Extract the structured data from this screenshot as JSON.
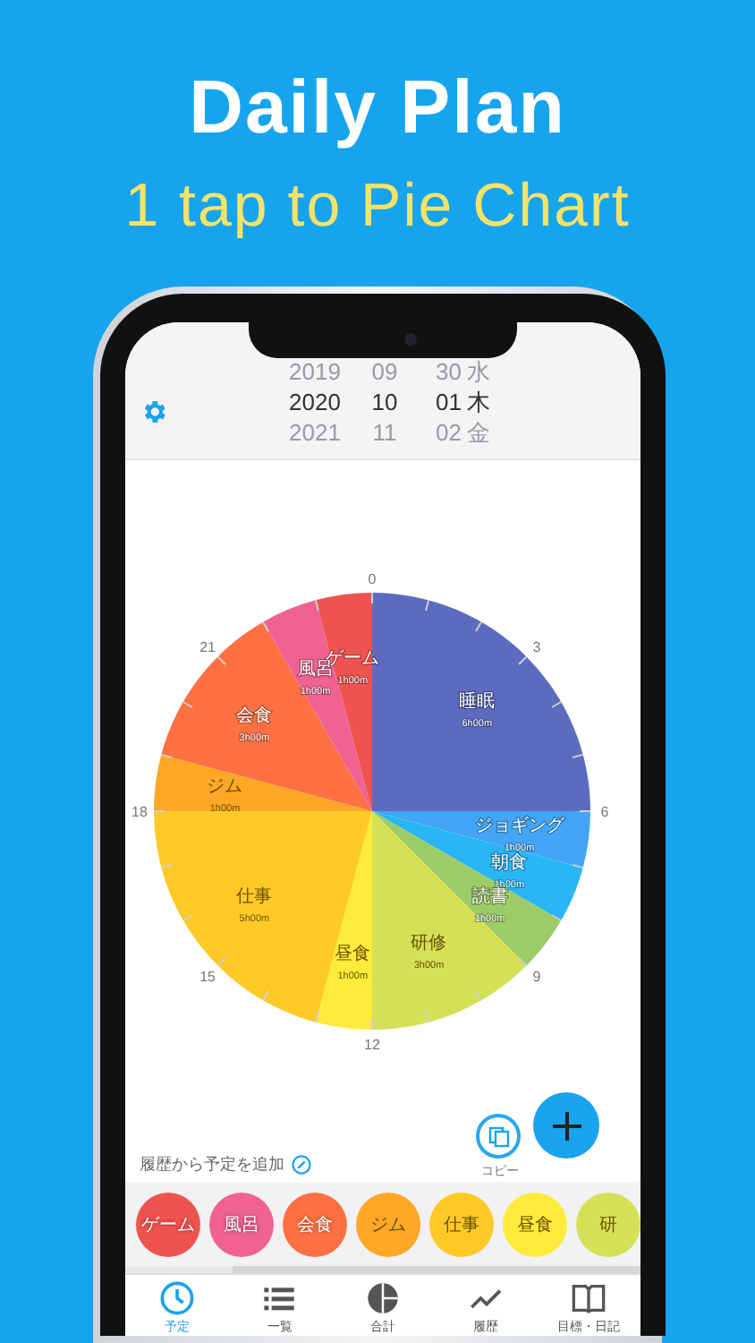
{
  "headline": "Daily Plan",
  "subtitle": "1 tap to Pie Chart",
  "date_picker": {
    "rows": [
      {
        "year": "2019",
        "month": "09",
        "day": "30",
        "weekday": "水",
        "selected": false
      },
      {
        "year": "2020",
        "month": "10",
        "day": "01",
        "weekday": "木",
        "selected": true
      },
      {
        "year": "2021",
        "month": "11",
        "day": "02",
        "weekday": "金",
        "selected": false
      }
    ]
  },
  "chart_data": {
    "type": "pie",
    "categories": [
      "睡眠",
      "ジョギング",
      "朝食",
      "読書",
      "研修",
      "昼食",
      "仕事",
      "ジム",
      "会食",
      "風呂",
      "ゲーム"
    ],
    "values": [
      6,
      1,
      1,
      1,
      3,
      1,
      5,
      1,
      3,
      1,
      1
    ],
    "value_labels": [
      "6h00m",
      "1h00m",
      "1h00m",
      "1h00m",
      "3h00m",
      "1h00m",
      "5h00m",
      "1h00m",
      "3h00m",
      "1h00m",
      "1h00m"
    ],
    "colors": [
      "#5c6bc0",
      "#42a5f5",
      "#29b6f6",
      "#9ccc65",
      "#d4e157",
      "#ffeb3b",
      "#ffca28",
      "#ffa726",
      "#ff7043",
      "#f06292",
      "#ef5350"
    ]
  },
  "clock_labels": [
    "0",
    "3",
    "6",
    "9",
    "12",
    "15",
    "18",
    "21"
  ],
  "history_link": "履歴から予定を追加",
  "copy_label": "コピー",
  "history_chips": [
    {
      "label": "ゲーム",
      "color": "#ef5350"
    },
    {
      "label": "風呂",
      "color": "#f06292"
    },
    {
      "label": "会食",
      "color": "#ff7043"
    },
    {
      "label": "ジム",
      "color": "#ffa726"
    },
    {
      "label": "仕事",
      "color": "#ffca28"
    },
    {
      "label": "昼食",
      "color": "#ffeb3b"
    },
    {
      "label": "研",
      "color": "#d4e157"
    }
  ],
  "tabs": [
    {
      "kind": "clock",
      "label": "予定",
      "selected": true
    },
    {
      "kind": "list",
      "label": "一覧",
      "selected": false
    },
    {
      "kind": "pie",
      "label": "合計",
      "selected": false
    },
    {
      "kind": "trend",
      "label": "履歴",
      "selected": false
    },
    {
      "kind": "book",
      "label": "目標・日記",
      "selected": false
    }
  ]
}
